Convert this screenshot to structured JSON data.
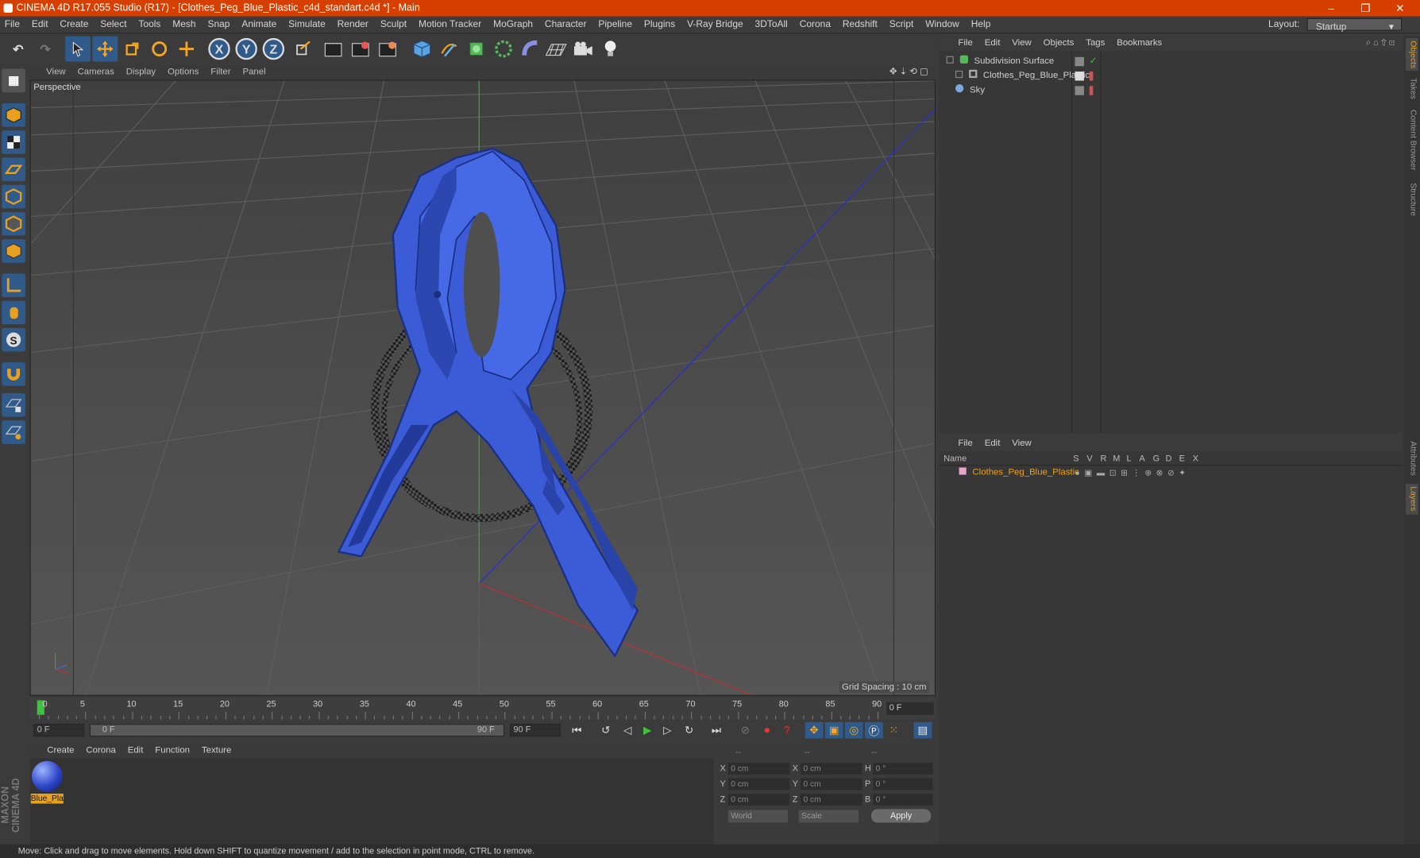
{
  "window": {
    "title": "CINEMA 4D R17.055 Studio (R17) - [Clothes_Peg_Blue_Plastic_c4d_standart.c4d *] - Main",
    "controls": [
      "–",
      "❐",
      "✕"
    ]
  },
  "menubar": {
    "items": [
      "File",
      "Edit",
      "Create",
      "Select",
      "Tools",
      "Mesh",
      "Snap",
      "Animate",
      "Simulate",
      "Render",
      "Sculpt",
      "Motion Tracker",
      "MoGraph",
      "Character",
      "Pipeline",
      "Plugins",
      "V-Ray Bridge",
      "3DToAll",
      "Corona",
      "Redshift",
      "Script",
      "Window",
      "Help"
    ],
    "layout_label": "Layout:",
    "layout_value": "Startup"
  },
  "toolbar": {
    "axis_labels": [
      "X",
      "Y",
      "Z"
    ]
  },
  "viewport": {
    "menu": [
      "View",
      "Cameras",
      "Display",
      "Options",
      "Filter",
      "Panel"
    ],
    "label": "Perspective",
    "grid_spacing": "Grid Spacing : 10 cm"
  },
  "timeline": {
    "ticks": [
      "0",
      "5",
      "10",
      "15",
      "20",
      "25",
      "30",
      "35",
      "40",
      "45",
      "50",
      "55",
      "60",
      "65",
      "70",
      "75",
      "80",
      "85",
      "90"
    ],
    "current_frame": "0 F"
  },
  "transport": {
    "start": "0 F",
    "range_start": "0 F",
    "range_end": "90 F",
    "end": "90 F"
  },
  "material_menu": {
    "items": [
      "Create",
      "Corona",
      "Edit",
      "Function",
      "Texture"
    ],
    "material_name": "Blue_Pla"
  },
  "coords": {
    "header": [
      "--",
      "--",
      "--"
    ],
    "rows": [
      {
        "a": "X",
        "av": "0 cm",
        "b": "X",
        "bv": "0 cm",
        "c": "H",
        "cv": "0 °"
      },
      {
        "a": "Y",
        "av": "0 cm",
        "b": "Y",
        "bv": "0 cm",
        "c": "P",
        "cv": "0 °"
      },
      {
        "a": "Z",
        "av": "0 cm",
        "b": "Z",
        "bv": "0 cm",
        "c": "B",
        "cv": "0 °"
      }
    ],
    "space": "World",
    "mode": "Scale",
    "apply": "Apply"
  },
  "object_manager": {
    "menu": [
      "File",
      "Edit",
      "View",
      "Objects",
      "Tags",
      "Bookmarks"
    ],
    "objects": [
      "Subdivision Surface",
      "Clothes_Peg_Blue_Plastic",
      "Sky"
    ]
  },
  "layer_manager": {
    "menu": [
      "File",
      "Edit",
      "View"
    ],
    "name_header": "Name",
    "columns": [
      "S",
      "V",
      "R",
      "M",
      "L",
      "A",
      "G",
      "D",
      "E",
      "X"
    ],
    "layer": "Clothes_Peg_Blue_Plastic"
  },
  "side_tabs": [
    "Objects",
    "Takes",
    "Content Browser",
    "Structure",
    "Attributes",
    "Layers"
  ],
  "brand": "MAXON CINEMA 4D",
  "status": "Move: Click and drag to move elements. Hold down SHIFT to quantize movement / add to the selection in point mode, CTRL to remove."
}
